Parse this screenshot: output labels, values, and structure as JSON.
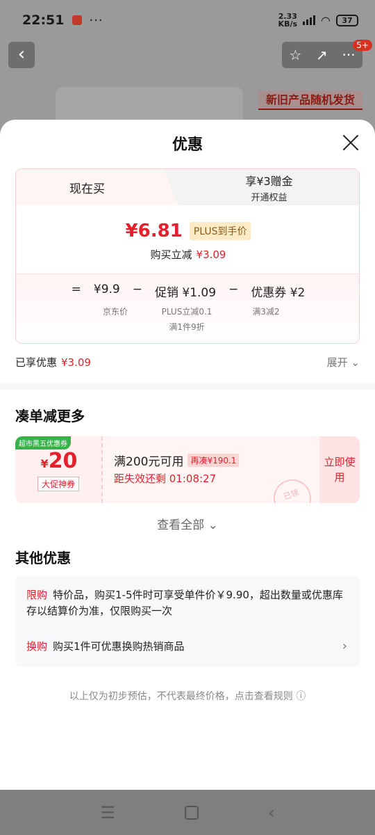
{
  "status": {
    "time": "22:51",
    "net_speed_top": "2.33",
    "net_speed_bottom": "KB/s",
    "battery": "37"
  },
  "nav": {
    "back": "‹",
    "star": "☆",
    "share": "↗",
    "more": "···",
    "badge": "5+"
  },
  "background": {
    "promo": "新旧产品随机发货"
  },
  "sheet": {
    "title": "优惠",
    "tabs": {
      "now": "现在买",
      "plus_main": "享¥3赠金",
      "plus_sub": "开通权益"
    },
    "price": {
      "final": "¥6.81",
      "plus_tag": "PLUS到手价",
      "reduce_label": "购买立减",
      "reduce_value": "¥3.09"
    },
    "breakdown": {
      "eq": "=",
      "jd_price": "¥9.9",
      "minus1": "−",
      "promo": "促销 ¥1.09",
      "minus2": "−",
      "coupon": "优惠券 ¥2",
      "jd_label": "京东价",
      "promo_label1": "PLUS立减0.1",
      "promo_label2": "满1件9折",
      "coupon_label": "满3减2"
    },
    "enjoyed": {
      "label": "已享优惠",
      "value": "¥3.09",
      "expand": "展开 ⌄"
    },
    "more_section": {
      "title": "凑单减更多",
      "view_all": "查看全部 ⌄"
    },
    "coupon": {
      "tag": "超市黑五优惠券",
      "amount": "20",
      "currency": "¥",
      "name": "大促神券",
      "condition": "满200元可用",
      "extra": "再凑¥190.1",
      "expire": "距失效还剩 01:08:27",
      "use": "立即使用",
      "stamp": "已领"
    },
    "other": {
      "title": "其他优惠",
      "item1_label": "限购",
      "item1_text": "特价品，购买1-5件时可享受单件价￥9.90，超出数量或优惠库存以结算价为准，仅限购买一次",
      "item2_label": "换购",
      "item2_text": "购买1件可优惠换购热销商品"
    },
    "footnote": "以上仅为初步预估，不代表最终价格，点击查看规则 ⓘ"
  },
  "navbar": {
    "menu": "☰",
    "home": "",
    "back": "‹"
  }
}
